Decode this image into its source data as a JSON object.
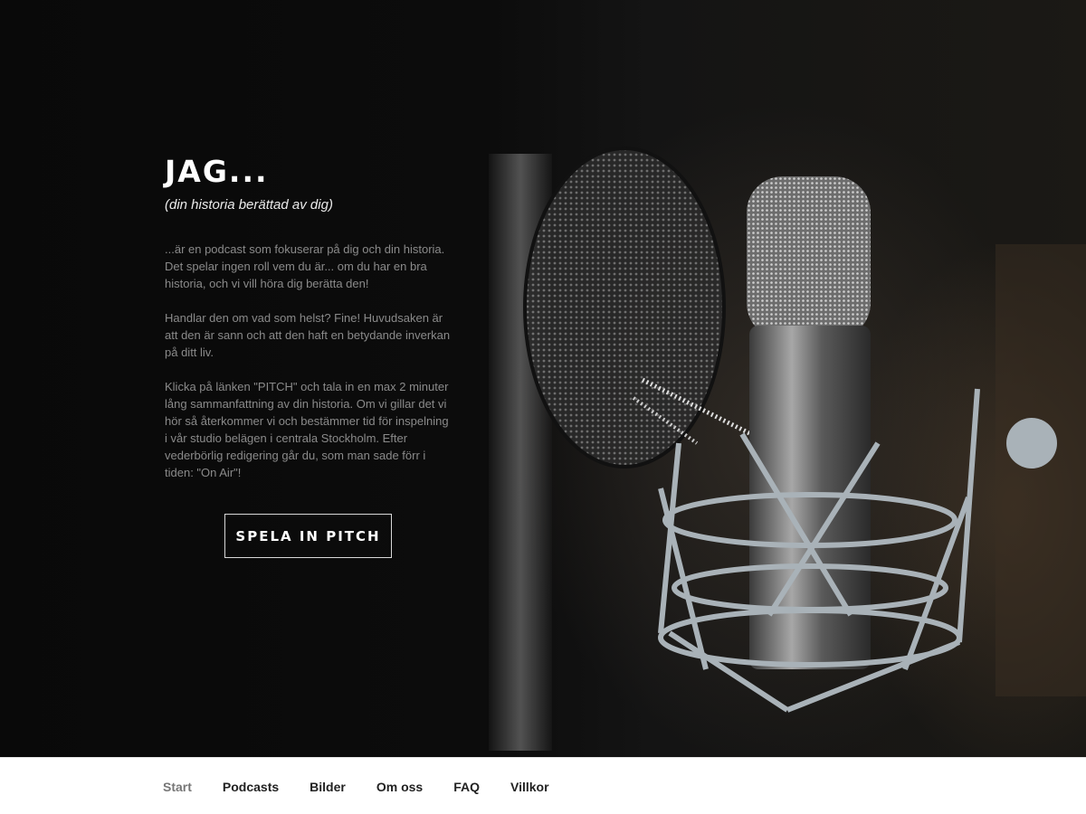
{
  "hero": {
    "title": "JAG...",
    "subtitle": "(din historia berättad av dig)",
    "paragraphs": [
      "...är en podcast som fokuserar på dig och din historia. Det spelar ingen roll vem du är... om du har en bra historia, och vi vill höra dig berätta den!",
      "Handlar den om vad som helst? Fine! Huvudsaken är att den är sann och att den haft en betydande inverkan på ditt liv.",
      "Klicka på länken \"PITCH\" och tala in en max 2 minuter lång sammanfattning av din historia. Om vi gillar det vi hör så återkommer vi och bestämmer tid för inspelning i vår studio belägen i centrala Stockholm. Efter vederbörlig redigering går du, som man sade förr i tiden: \"On Air\"!"
    ],
    "button_label": "SPELA IN PITCH",
    "image": "studio-microphone-photo"
  },
  "nav": {
    "items": [
      "Start",
      "Podcasts",
      "Bilder",
      "Om oss",
      "FAQ",
      "Villkor"
    ],
    "active": "Start"
  },
  "colors": {
    "background": "#0b0b0b",
    "title": "#ffffff",
    "body_text": "#8a8a8a",
    "nav_active": "#767676",
    "nav_text": "#222222"
  }
}
